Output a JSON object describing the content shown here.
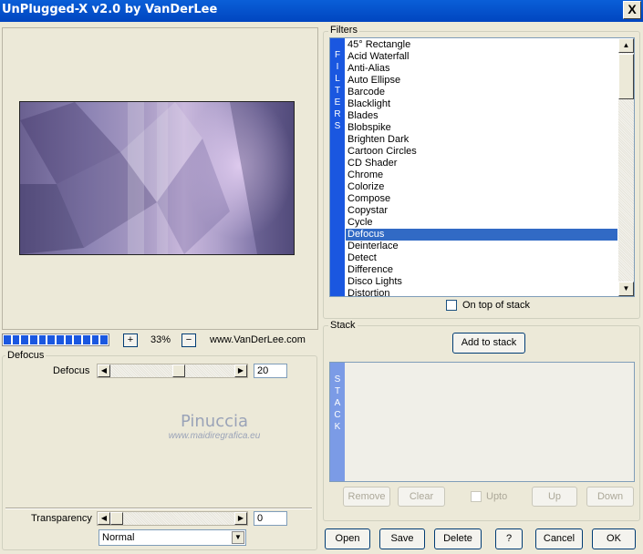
{
  "window": {
    "title": "UnPlugged-X v2.0 by VanDerLee",
    "close_glyph": "X"
  },
  "preview": {
    "zoom_plus": "+",
    "zoom_minus": "−",
    "zoom_level": "33%",
    "progress_fraction": 1.0,
    "progress_segments": 12,
    "website": "www.VanDerLee.com"
  },
  "filters": {
    "group_label": "Filters",
    "band_letters": [
      "F",
      "I",
      "L",
      "T",
      "E",
      "R",
      "S"
    ],
    "items": [
      "45° Rectangle",
      "Acid Waterfall",
      "Anti-Alias",
      "Auto Ellipse",
      "Barcode",
      "Blacklight",
      "Blades",
      "Blobspike",
      "Brighten Dark",
      "Cartoon Circles",
      "CD Shader",
      "Chrome",
      "Colorize",
      "Compose",
      "Copystar",
      "Cycle",
      "Defocus",
      "Deinterlace",
      "Detect",
      "Difference",
      "Disco Lights",
      "Distortion"
    ],
    "selected": "Defocus",
    "on_top_label": "On top of stack",
    "on_top_checked": false
  },
  "stack": {
    "group_label": "Stack",
    "add_button": "Add to stack",
    "band_letters": [
      "S",
      "T",
      "A",
      "C",
      "K"
    ],
    "remove_button": "Remove",
    "clear_button": "Clear",
    "upto_label": "Upto",
    "up_button": "Up",
    "down_button": "Down"
  },
  "params": {
    "group_label": "Defocus",
    "defocus_label": "Defocus",
    "defocus_value": "20",
    "defocus_fraction": 0.2,
    "transparency_label": "Transparency",
    "transparency_value": "0",
    "transparency_fraction": 0.0,
    "blend_mode": "Normal"
  },
  "watermark": {
    "line1": "Pinuccia",
    "line2": "www.maidiregrafica.eu"
  },
  "buttons": {
    "open": "Open",
    "save": "Save",
    "delete": "Delete",
    "help": "?",
    "cancel": "Cancel",
    "ok": "OK"
  },
  "colors": {
    "selection": "#316ac5",
    "band": "#1a57e0",
    "titlebar": "#0a5fd8"
  }
}
